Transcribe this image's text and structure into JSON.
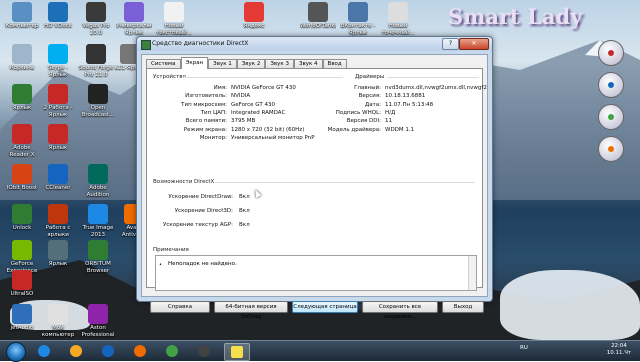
{
  "desktop": {
    "watermark": "Smart Lady",
    "icons": [
      {
        "label": "Компьютер",
        "color": "#5a8fc4"
      },
      {
        "label": "HD VDeck",
        "color": "#1d6fb7"
      },
      {
        "label": "Vegas Pro 10.0",
        "color": "#3a3a3a"
      },
      {
        "label": "Универсальн... Ярлык",
        "color": "#7a5fd6"
      },
      {
        "label": "Новый текстовый...",
        "color": "#f1f1f1"
      },
      {
        "label": "Яндекс",
        "color": "#e53935"
      },
      {
        "label": "WorldOfTanks",
        "color": "#555"
      },
      {
        "label": "ВКонтакте - Ярлык",
        "color": "#4a76a8"
      },
      {
        "label": "Новый точечный...",
        "color": "#ddd"
      },
      {
        "label": "Корзина",
        "color": "#9fb5c9"
      },
      {
        "label": "Ярлык",
        "color": "#2e7d32"
      },
      {
        "label": "Skype - Ярлык",
        "color": "#00aff0"
      },
      {
        "label": "Sound Forge Pro 11.0",
        "color": "#333"
      },
      {
        "label": "a11-Ярлык",
        "color": "#777"
      },
      {
        "label": "Adobe Reader X",
        "color": "#c62828"
      },
      {
        "label": "2 Работа - Ярлык",
        "color": "#c62828"
      },
      {
        "label": "Open Broadcast...",
        "color": "#222"
      },
      {
        "label": "IObit Boost",
        "color": "#d84315"
      },
      {
        "label": "Ярлык",
        "color": "#c62828"
      },
      {
        "label": "Unlock",
        "color": "#2e7d32"
      },
      {
        "label": "CCleaner",
        "color": "#1565c0"
      },
      {
        "label": "Adobe Audition",
        "color": "#00695c"
      },
      {
        "label": "GeForce Experience",
        "color": "#76b900"
      },
      {
        "label": "Работа с ярлыки",
        "color": "#bf360c"
      },
      {
        "label": "True Image 2013",
        "color": "#1e88e5"
      },
      {
        "label": "Avast Antivirus",
        "color": "#ef6c00"
      },
      {
        "label": "UltraISO",
        "color": "#c62828"
      },
      {
        "label": "Ярлык",
        "color": "#546e7a"
      },
      {
        "label": "ORBITUM Browser",
        "color": "#2e7d32"
      },
      {
        "label": "jetAudio",
        "color": "#2f6fba"
      },
      {
        "label": "Мой компьютер",
        "color": "#e0e0e0"
      },
      {
        "label": "Aston Professional",
        "color": "#8e24aa"
      }
    ]
  },
  "window": {
    "title": "Средство диагностики DirectX",
    "help_label": "?",
    "close_label": "✕",
    "tabs": [
      "Система",
      "Экран",
      "Звук 1",
      "Звук 2",
      "Звук 3",
      "Звук 4",
      "Ввод"
    ],
    "device": {
      "heading": "Устройство",
      "rows": [
        {
          "k": "Имя:",
          "v": "NVIDIA GeForce GT 430"
        },
        {
          "k": "Изготовитель:",
          "v": "NVIDIA"
        },
        {
          "k": "Тип микросхем:",
          "v": "GeForce GT 430"
        },
        {
          "k": "Тип ЦАП:",
          "v": "Integrated RAMDAC"
        },
        {
          "k": "Всего памяти:",
          "v": "3795 MB"
        },
        {
          "k": "Режим экрана:",
          "v": "1280 x 720 (32 bit) (60Hz)"
        },
        {
          "k": "Монитор:",
          "v": "Универсальный монитор PnP"
        }
      ]
    },
    "drivers": {
      "heading": "Драйверы",
      "rows": [
        {
          "k": "Главный:",
          "v": "nvd3dumx.dll,nvwgf2umx.dll,nvwgf2"
        },
        {
          "k": "Версия:",
          "v": "10.18.13.6881"
        },
        {
          "k": "Дата:",
          "v": "11.07.Пн 5:13:48"
        },
        {
          "k": "Подпись WHQL:",
          "v": "Н/Д"
        },
        {
          "k": "Версия DDI:",
          "v": "11"
        },
        {
          "k": "Модель драйвера:",
          "v": "WDDM 1.1"
        }
      ]
    },
    "features": {
      "heading": "Возможности DirectX",
      "rows": [
        {
          "k": "Ускорение DirectDraw:",
          "v": "Вкл"
        },
        {
          "k": "Ускорение Direct3D:",
          "v": "Вкл"
        },
        {
          "k": "Ускорение текстур AGP:",
          "v": "Вкл"
        }
      ]
    },
    "notes": {
      "heading": "Примечания",
      "text": "Неполадок не найдено."
    },
    "buttons": {
      "help": "Справка",
      "dxdiag64": "64-битная версия DxDiag",
      "next": "Следующая страница",
      "save": "Сохранить все сведения...",
      "exit": "Выход"
    }
  },
  "taskbar": {
    "language": "RU",
    "time": "22:04",
    "date": "10.11.Чт",
    "items": [
      {
        "name": "ie",
        "color": "#1e88e5"
      },
      {
        "name": "explorer",
        "color": "#f9a825"
      },
      {
        "name": "media-player",
        "color": "#1565c0"
      },
      {
        "name": "firefox",
        "color": "#ef6c00"
      },
      {
        "name": "chrome",
        "color": "#43a047"
      },
      {
        "name": "obs",
        "color": "#424242"
      },
      {
        "name": "dxdiag",
        "color": "#f4e04d"
      }
    ]
  }
}
